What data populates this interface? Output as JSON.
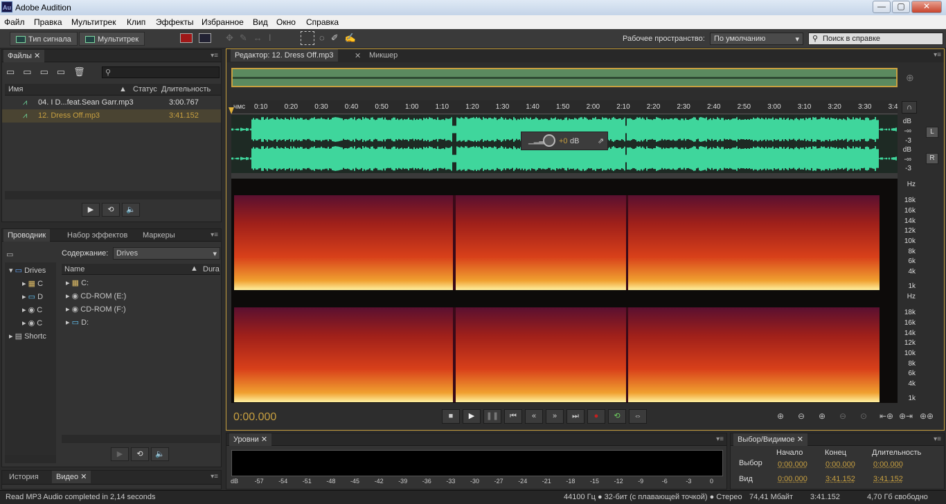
{
  "window": {
    "app_icon": "Au",
    "title": "Adobe Audition",
    "minimize": "—",
    "maximize": "▢",
    "close": "✕"
  },
  "menu": [
    "Файл",
    "Правка",
    "Мультитрек",
    "Клип",
    "Эффекты",
    "Избранное",
    "Вид",
    "Окно",
    "Справка"
  ],
  "toolbar": {
    "waveform_label": "Тип сигнала",
    "multitrack_label": "Мультитрек",
    "workspace_label": "Рабочее пространство:",
    "workspace_value": "По умолчанию",
    "search_placeholder": "Поиск в справке"
  },
  "files_panel": {
    "tab": "Файлы",
    "columns": {
      "name": "Имя",
      "status": "Статус",
      "duration": "Длительность"
    },
    "items": [
      {
        "name": "04. I D...feat.Sean Garr.mp3",
        "duration": "3:00.767"
      },
      {
        "name": "12. Dress Off.mp3",
        "duration": "3:41.152"
      }
    ]
  },
  "browser_panel": {
    "tabs": [
      "Проводник",
      "Набор эффектов",
      "Маркеры"
    ],
    "content_label": "Содержание:",
    "content_value": "Drives",
    "tree": [
      {
        "label": "Drives"
      },
      {
        "label": "C"
      },
      {
        "label": "D"
      },
      {
        "label": "C"
      },
      {
        "label": "C"
      },
      {
        "label": "Shortc"
      }
    ],
    "columns": {
      "name": "Name",
      "duration": "Dura"
    },
    "drives": [
      "C:",
      "CD-ROM (E:)",
      "CD-ROM (F:)",
      "D:"
    ]
  },
  "history_panel": {
    "tabs": [
      "История",
      "Видео"
    ]
  },
  "editor": {
    "tab": "Редактор: 12. Dress Off.mp3",
    "mixer_tab": "Микшер",
    "ruler_unit": "чмс",
    "ticks": [
      "0:10",
      "0:20",
      "0:30",
      "0:40",
      "0:50",
      "1:00",
      "1:10",
      "1:20",
      "1:30",
      "1:40",
      "1:50",
      "2:00",
      "2:10",
      "2:20",
      "2:30",
      "2:40",
      "2:50",
      "3:00",
      "3:10",
      "3:20",
      "3:30",
      "3:4"
    ],
    "db_scale": [
      "dB",
      "-∞",
      "-3",
      "dB",
      "-∞",
      "-3"
    ],
    "channel_l": "L",
    "channel_r": "R",
    "hud_gain": "+0",
    "hud_unit": "dB",
    "freq_scale": [
      "Hz",
      "18k",
      "16k",
      "14k",
      "12k",
      "10k",
      "8k",
      "6k",
      "4k",
      "1k"
    ],
    "time": "0:00.000"
  },
  "levels": {
    "tab": "Уровни",
    "scale": [
      "dB",
      "-57",
      "-54",
      "-51",
      "-48",
      "-45",
      "-42",
      "-39",
      "-36",
      "-33",
      "-30",
      "-27",
      "-24",
      "-21",
      "-18",
      "-15",
      "-12",
      "-9",
      "-6",
      "-3",
      "0"
    ]
  },
  "selection": {
    "tab": "Выбор/Видимое",
    "columns": [
      "Начало",
      "Конец",
      "Длительность"
    ],
    "rows": [
      {
        "label": "Выбор",
        "start": "0:00.000",
        "end": "0:00.000",
        "duration": "0:00.000"
      },
      {
        "label": "Вид",
        "start": "0:00.000",
        "end": "3:41.152",
        "duration": "3:41.152"
      }
    ]
  },
  "status": {
    "message": "Read MP3 Audio completed in 2,14 seconds",
    "format": "44100 Гц ● 32-бит (с плавающей точкой) ● Стерео",
    "size": "74,41 Мбайт",
    "duration": "3:41.152",
    "free": "4,70 Гб свободно"
  }
}
